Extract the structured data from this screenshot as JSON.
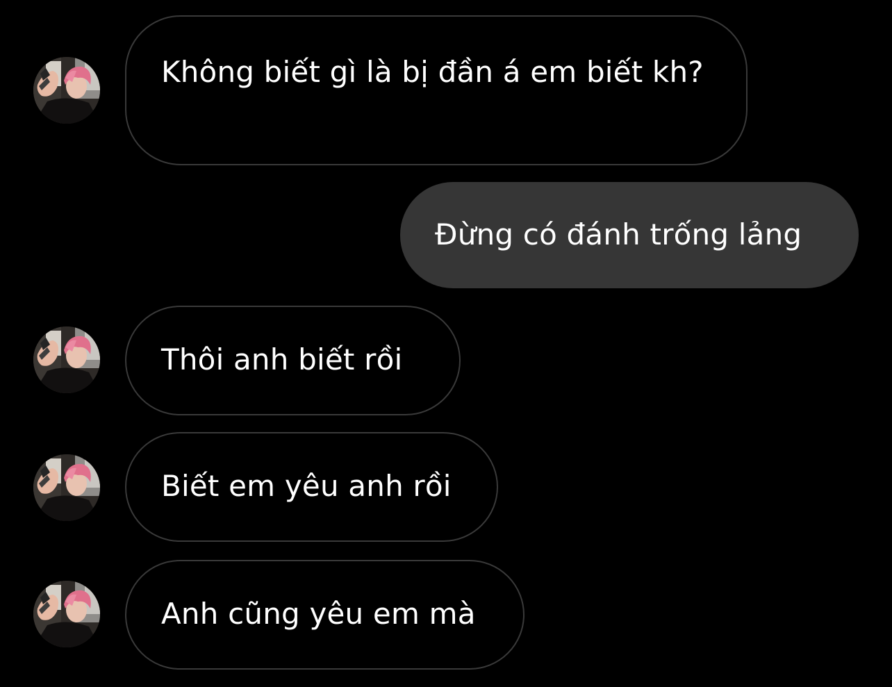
{
  "conversation": {
    "messages": [
      {
        "text": "Không biết gì là bị đần á em biết kh?",
        "direction": "received",
        "avatar": "profile-photo"
      },
      {
        "text": "Đừng có đánh trống lảng",
        "direction": "sent"
      },
      {
        "text": "Thôi anh biết rồi",
        "direction": "received",
        "avatar": "profile-photo"
      },
      {
        "text": "Biết em yêu anh rồi",
        "direction": "received",
        "avatar": "profile-photo"
      },
      {
        "text": "Anh cũng yêu em mà",
        "direction": "received",
        "avatar": "profile-photo"
      }
    ]
  },
  "colors": {
    "background": "#000000",
    "received_bubble_border": "#3a3a3a",
    "sent_bubble_background": "#363636",
    "text": "#ffffff"
  }
}
